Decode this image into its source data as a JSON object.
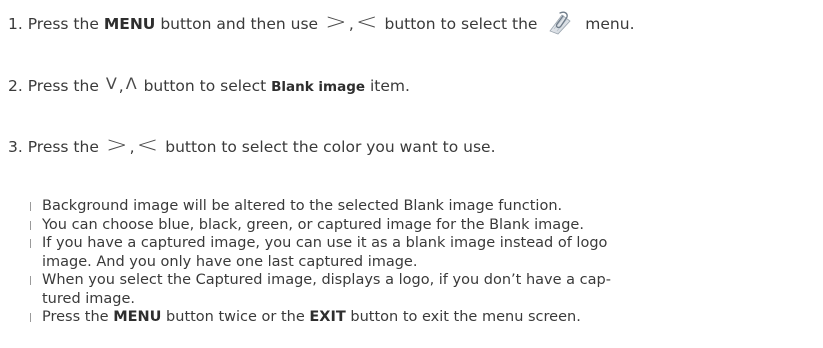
{
  "step1": {
    "prefix": "1. Press the ",
    "menu": "MENU",
    "mid": " button and then use ",
    "right": ">",
    "comma": ",",
    "left": "<",
    "mid2": " button to select the ",
    "icon": "paper-clip-icon",
    "suffix": " menu."
  },
  "step2": {
    "prefix": "2. Press the ",
    "down": "V",
    "comma": ",",
    "up": "Λ",
    "mid": " button to select ",
    "item": "Blank image",
    "suffix": " item."
  },
  "step3": {
    "prefix": "3. Press the ",
    "right": ">",
    "comma": ",",
    "left": "<",
    "suffix": " button to select the color you want to use."
  },
  "bullets": {
    "b1": "Background image will be altered to the selected Blank image function.",
    "b2": "You can choose blue, black, green, or captured image for the Blank image.",
    "b3_line1": "If you have a captured image, you can use it as a blank image instead of logo",
    "b3_line2": "image. And you only have one last captured image.",
    "b4_line1": "When you select the Captured image, displays a logo, if you don’t have a cap-",
    "b4_line2": "tured image.",
    "b5_prefix": "Press the ",
    "b5_menu": "MENU",
    "b5_mid": " button twice or the ",
    "b5_exit": "EXIT",
    "b5_suffix": " button to exit the menu screen."
  }
}
